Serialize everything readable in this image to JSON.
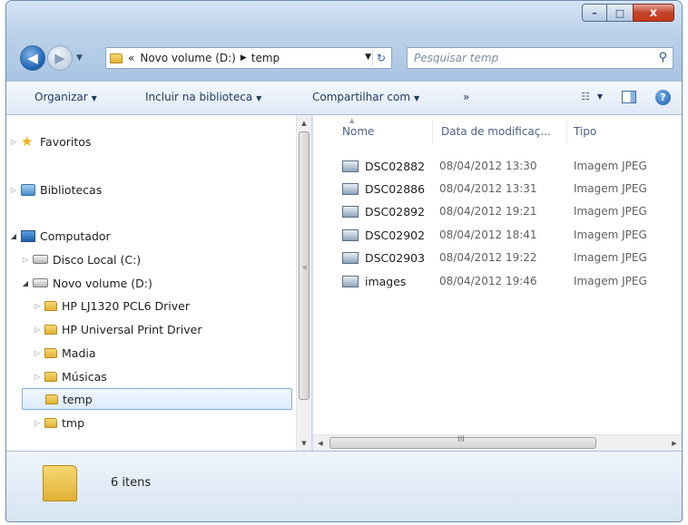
{
  "window": {
    "caption_buttons": {
      "minimize": "–",
      "maximize": "□",
      "close": "x"
    }
  },
  "nav": {
    "back_glyph": "◀",
    "forward_glyph": "▶",
    "recent_glyph": "▼"
  },
  "address": {
    "prefix": "«",
    "path": [
      "Novo volume (D:)",
      "temp"
    ],
    "separator": "▶",
    "dropdown_glyph": "▼",
    "refresh_glyph": "↻"
  },
  "search": {
    "placeholder": "Pesquisar temp",
    "icon": "search-icon"
  },
  "toolbar": {
    "organize": "Organizar",
    "include_library": "Incluir na biblioteca",
    "share": "Compartilhar com",
    "more": "»",
    "dropdown_glyph": "▼",
    "help_glyph": "?"
  },
  "tree": {
    "favorites": "Favoritos",
    "libraries": "Bibliotecas",
    "computer": "Computador",
    "local_disk": "Disco Local (C:)",
    "new_volume": "Novo volume (D:)",
    "folders": [
      "HP LJ1320 PCL6 Driver",
      "HP Universal Print Driver",
      "Madia",
      "Músicas",
      "temp",
      "tmp"
    ],
    "selected_folder": "temp"
  },
  "columns": {
    "name": "Nome",
    "date": "Data de modificaç...",
    "type": "Tipo"
  },
  "files": [
    {
      "name": "DSC02882",
      "date": "08/04/2012 13:30",
      "type": "Imagem JPEG"
    },
    {
      "name": "DSC02886",
      "date": "08/04/2012 13:31",
      "type": "Imagem JPEG"
    },
    {
      "name": "DSC02892",
      "date": "08/04/2012 19:21",
      "type": "Imagem JPEG"
    },
    {
      "name": "DSC02902",
      "date": "08/04/2012 18:41",
      "type": "Imagem JPEG"
    },
    {
      "name": "DSC02903",
      "date": "08/04/2012 19:22",
      "type": "Imagem JPEG"
    },
    {
      "name": "images",
      "date": "08/04/2012 19:46",
      "type": "Imagem JPEG"
    }
  ],
  "status": {
    "item_count": "6 itens"
  },
  "scroll": {
    "grip": "≡",
    "hgrip": "III"
  }
}
